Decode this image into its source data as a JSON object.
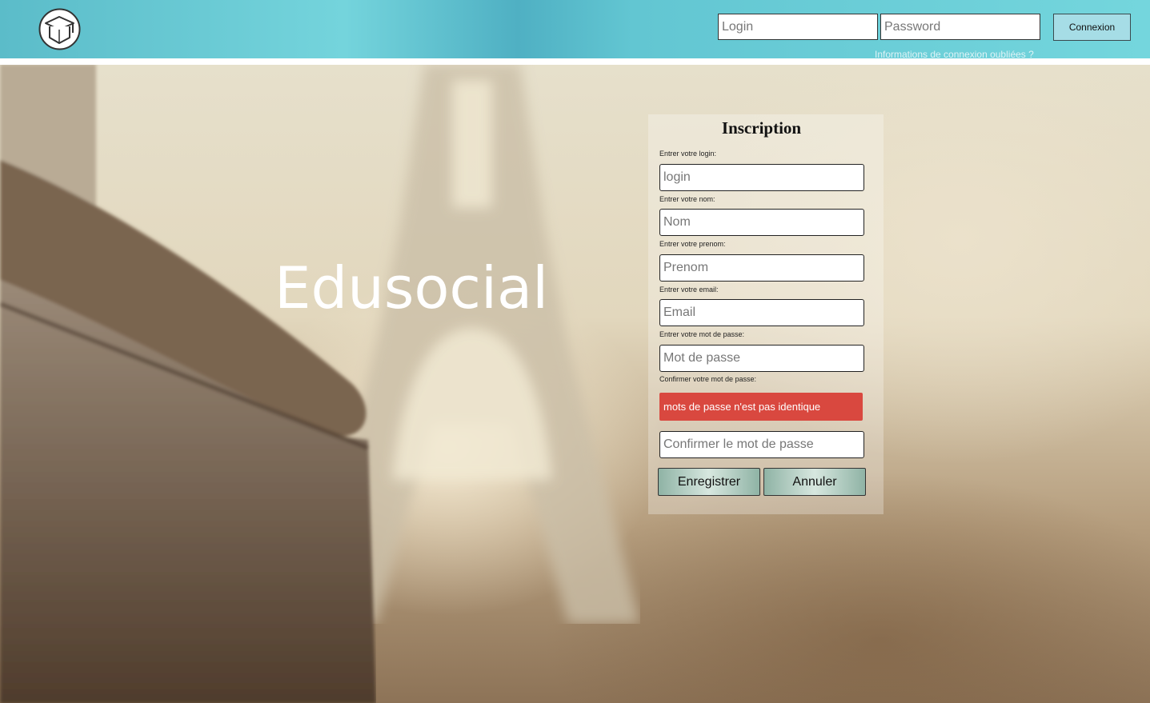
{
  "header": {
    "login_placeholder": "Login",
    "password_placeholder": "Password",
    "connexion_label": "Connexion",
    "forgot_link": "Informations de connexion oubliées ?",
    "accent_color": "#6fd0da"
  },
  "brand": {
    "name": "Edusocial",
    "logo_icon": "graduation-cap-icon"
  },
  "form": {
    "title": "Inscription",
    "fields": [
      {
        "label": "Entrer votre login:",
        "placeholder": "login"
      },
      {
        "label": "Entrer votre nom:",
        "placeholder": "Nom"
      },
      {
        "label": "Entrer votre prenom:",
        "placeholder": "Prenom"
      },
      {
        "label": "Entrer votre email:",
        "placeholder": "Email"
      },
      {
        "label": "Entrer votre mot de passe:",
        "placeholder": "Mot de passe"
      },
      {
        "label": "Confirmer votre mot de passe:",
        "placeholder": "Confirmer le mot de passe"
      }
    ],
    "error_message": "mots de passe n'est pas identique",
    "error_color": "#d9483f",
    "save_label": "Enregistrer",
    "cancel_label": "Annuler"
  }
}
